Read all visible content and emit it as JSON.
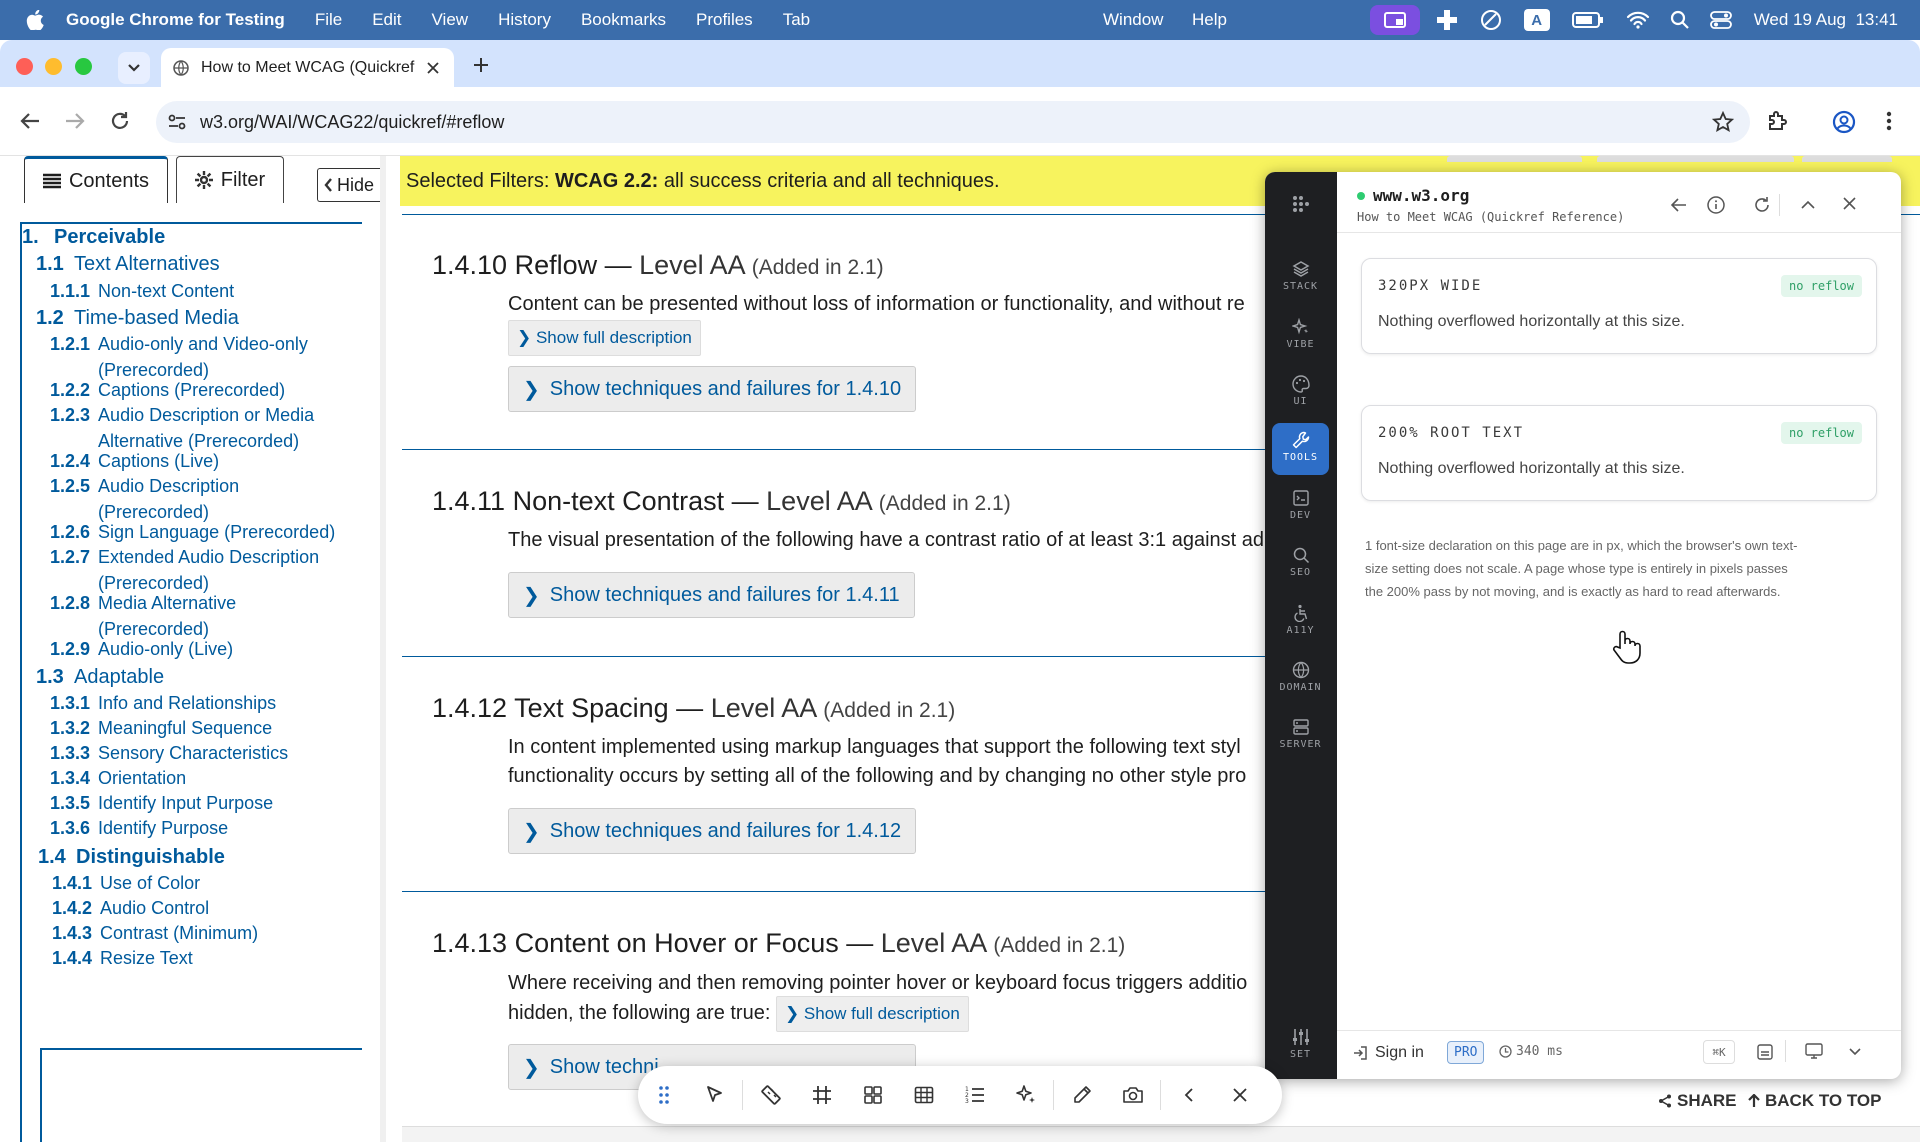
{
  "menubar": {
    "app": "Google Chrome for Testing",
    "items": [
      "File",
      "Edit",
      "View",
      "History",
      "Bookmarks",
      "Profiles",
      "Tab"
    ],
    "items_right": [
      "Window",
      "Help"
    ],
    "status_icons": [
      "screen-mirror-icon",
      "medical-plus-icon",
      "no-entry-icon",
      "keyboard-input-icon",
      "battery-icon",
      "wifi-icon",
      "search-icon",
      "control-center-icon"
    ],
    "clock": "Wed 19 Aug  13:41"
  },
  "browser": {
    "tab_title": "How to Meet WCAG (Quickref",
    "url": "w3.org/WAI/WCAG22/quickref/#reflow"
  },
  "sidebar": {
    "tabs": {
      "contents": "Contents",
      "filter": "Filter",
      "hide": "Hide"
    },
    "toc": [
      {
        "num": "1.",
        "label": "Perceivable",
        "level": 1
      },
      {
        "num": "1.1",
        "label": "Text Alternatives",
        "level": 2
      },
      {
        "num": "1.1.1",
        "label": "Non-text Content",
        "level": 3
      },
      {
        "num": "1.2",
        "label": "Time-based Media",
        "level": 2
      },
      {
        "num": "1.2.1",
        "label": "Audio-only and Video-only",
        "label2": "(Prerecorded)",
        "level": 3
      },
      {
        "num": "1.2.2",
        "label": "Captions (Prerecorded)",
        "level": 3
      },
      {
        "num": "1.2.3",
        "label": "Audio Description or Media",
        "label2": "Alternative (Prerecorded)",
        "level": 3
      },
      {
        "num": "1.2.4",
        "label": "Captions (Live)",
        "level": 3
      },
      {
        "num": "1.2.5",
        "label": "Audio Description",
        "label2": "(Prerecorded)",
        "level": 3
      },
      {
        "num": "1.2.6",
        "label": "Sign Language (Prerecorded)",
        "level": 3
      },
      {
        "num": "1.2.7",
        "label": "Extended Audio Description",
        "label2": "(Prerecorded)",
        "level": 3
      },
      {
        "num": "1.2.8",
        "label": "Media Alternative",
        "label2": "(Prerecorded)",
        "level": 3
      },
      {
        "num": "1.2.9",
        "label": "Audio-only (Live)",
        "level": 3
      },
      {
        "num": "1.3",
        "label": "Adaptable",
        "level": 2
      },
      {
        "num": "1.3.1",
        "label": "Info and Relationships",
        "level": 3
      },
      {
        "num": "1.3.2",
        "label": "Meaningful Sequence",
        "level": 3
      },
      {
        "num": "1.3.3",
        "label": "Sensory Characteristics",
        "level": 3
      },
      {
        "num": "1.3.4",
        "label": "Orientation",
        "level": 3
      },
      {
        "num": "1.3.5",
        "label": "Identify Input Purpose",
        "level": 3
      },
      {
        "num": "1.3.6",
        "label": "Identify Purpose",
        "level": 3
      },
      {
        "num": "1.4",
        "label": "Distinguishable",
        "level": 2
      },
      {
        "num": "1.4.1",
        "label": "Use of Color",
        "level": 3
      },
      {
        "num": "1.4.2",
        "label": "Audio Control",
        "level": 3
      },
      {
        "num": "1.4.3",
        "label": "Contrast (Minimum)",
        "level": 3
      },
      {
        "num": "1.4.4",
        "label": "Resize Text",
        "level": 3
      }
    ]
  },
  "filterbar": {
    "prefix": "Selected Filters: ",
    "strong": "WCAG 2.2:",
    "rest": " all success criteria and all techniques."
  },
  "criteria": [
    {
      "title": "1.4.10 Reflow — ",
      "level": "Level AA",
      "added": "(Added in 2.1)",
      "desc": "Content can be presented without loss of information or functionality, and without re",
      "show_full": "Show full description",
      "tech": "Show techniques and failures for 1.4.10"
    },
    {
      "title": "1.4.11 Non-text Contrast — ",
      "level": "Level AA",
      "added": "(Added in 2.1)",
      "desc": "The visual presentation of the following have a contrast ratio of at least 3:1 against ad",
      "tech": "Show techniques and failures for 1.4.11"
    },
    {
      "title": "1.4.12 Text Spacing — ",
      "level": "Level AA",
      "added": "(Added in 2.1)",
      "desc": "In content implemented using markup languages that support the following text styl",
      "desc2": "functionality occurs by setting all of the following and by changing no other style pro",
      "tech": "Show techniques and failures for 1.4.12"
    },
    {
      "title": "1.4.13 Content on Hover or Focus — ",
      "level": "Level AA",
      "added": "(Added in 2.1)",
      "desc": "Where receiving and then removing pointer hover or keyboard focus triggers additio",
      "desc2": "hidden, the following are true: ",
      "show_full": "Show full description",
      "tech": "Show techni"
    }
  ],
  "page_footer": {
    "share": "SHARE",
    "back_to_top": "BACK TO TOP"
  },
  "extension": {
    "domain": "www.w3.org",
    "page_title": "How to Meet WCAG (Quickref Reference)",
    "nav": [
      {
        "label": "STACK",
        "icon": "layers-icon"
      },
      {
        "label": "VIBE",
        "icon": "sparkle-icon"
      },
      {
        "label": "UI",
        "icon": "palette-icon"
      },
      {
        "label": "TOOLS",
        "icon": "wrench-icon",
        "active": true
      },
      {
        "label": "DEV",
        "icon": "terminal-icon"
      },
      {
        "label": "SEO",
        "icon": "search-icon"
      },
      {
        "label": "A11Y",
        "icon": "accessibility-icon"
      },
      {
        "label": "DOMAIN",
        "icon": "globe-icon"
      },
      {
        "label": "SERVER",
        "icon": "server-icon"
      }
    ],
    "set_label": "SET",
    "cards": [
      {
        "title": "320PX WIDE",
        "badge": "no reflow",
        "body": "Nothing overflowed horizontally at this size."
      },
      {
        "title": "200% ROOT TEXT",
        "badge": "no reflow",
        "body": "Nothing overflowed horizontally at this size."
      }
    ],
    "note": [
      "1 font-size declaration on this page are in px, which the browser's own text-",
      "size setting does not scale. A page whose type is entirely in pixels passes",
      "the 200% pass by not moving, and is exactly as hard to read afterwards."
    ],
    "footer": {
      "sign_in": "Sign in",
      "pro": "PRO",
      "timing": "340 ms",
      "shortcut": "⌘K"
    },
    "colors": {
      "accent": "#2e6ec7",
      "badge_bg": "#e3f6ec",
      "badge_text": "#2e9f66",
      "status_dot": "#2ecc71"
    }
  },
  "floating_toolbar": {
    "tools": [
      "drag-handle-icon",
      "pointer-icon",
      "ruler-icon",
      "frame-icon",
      "grid-icon",
      "table-icon",
      "list-icon",
      "sparkle-icon",
      "color-picker-icon",
      "camera-icon",
      "chevron-left-icon",
      "close-icon"
    ]
  }
}
